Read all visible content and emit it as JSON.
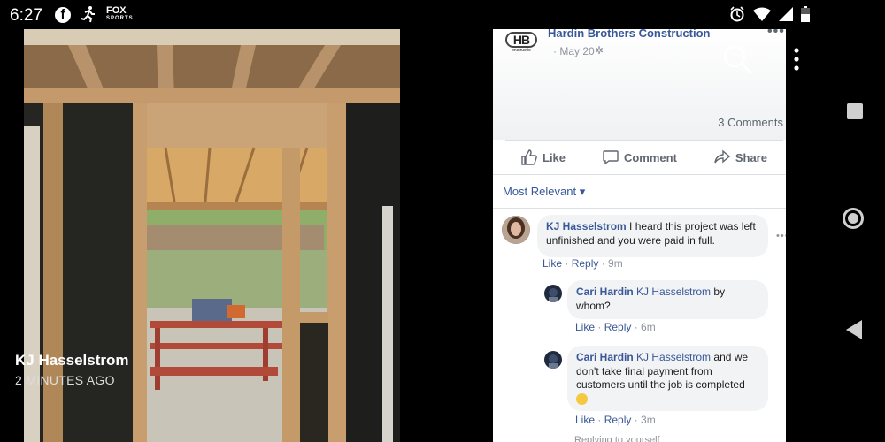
{
  "status_bar": {
    "time": "6:27",
    "icons_left": [
      "facebook-icon",
      "running-icon",
      "fox-sports-icon"
    ],
    "fox_label": "FOX",
    "fox_sub": "SPORTS",
    "icons_right": [
      "alarm-icon",
      "wifi-icon",
      "signal-icon",
      "battery-icon"
    ]
  },
  "story": {
    "user": "KJ Hasselstrom",
    "time": "2 MINUTES AGO"
  },
  "overlay": {
    "search_icon": "search-icon",
    "menu_icon": "vertical-dots-icon"
  },
  "post": {
    "page_name": "Hardin Brothers Construction",
    "logo_text": "HB",
    "logo_subtext": "onstructio",
    "date": "May 20",
    "privacy_icon": "gear-icon",
    "more_label": "•••",
    "comment_count": "3 Comments",
    "actions": {
      "like": "Like",
      "comment": "Comment",
      "share": "Share"
    },
    "sort_label": "Most Relevant ▾",
    "comments": [
      {
        "author": "KJ Hasselstrom",
        "text": " I heard this project was left unfinished and you were paid in full.",
        "like": "Like",
        "reply": "Reply",
        "time": "9m"
      },
      {
        "author": "Cari Hardin",
        "mention": "KJ Hasselstrom",
        "text": " by whom?",
        "like": "Like",
        "reply": "Reply",
        "time": "6m"
      },
      {
        "author": "Cari Hardin",
        "mention": "KJ Hasselstrom",
        "text": " and we don't take final payment from customers until the job is completed",
        "like": "Like",
        "reply": "Reply",
        "time": "3m"
      }
    ],
    "reply_prompt": "Replying to yourself"
  },
  "nav": {
    "recents": "square-icon",
    "home": "home-circle-icon",
    "back": "back-triangle-icon"
  },
  "colors": {
    "link": "#385898",
    "meta": "#90949c",
    "bubble": "#f2f3f5"
  }
}
